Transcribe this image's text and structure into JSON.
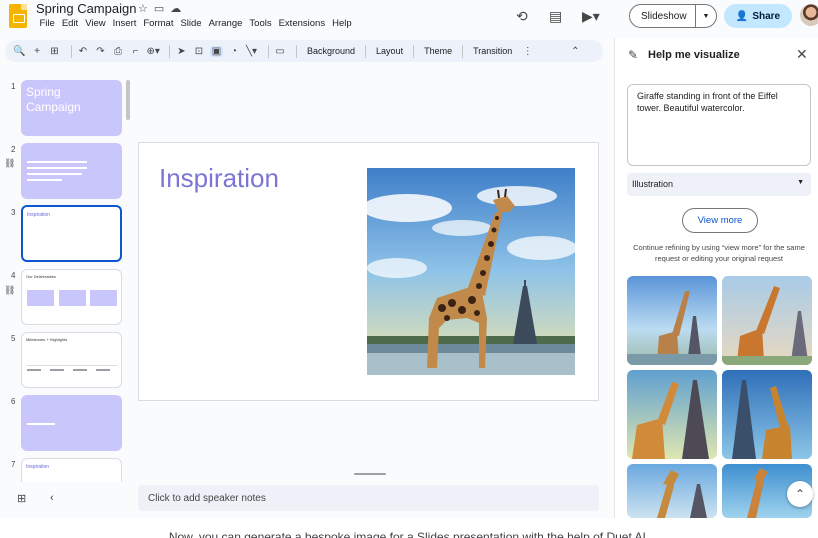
{
  "header": {
    "title": "Spring Campaign",
    "menu": [
      "File",
      "Edit",
      "View",
      "Insert",
      "Format",
      "Slide",
      "Arrange",
      "Tools",
      "Extensions",
      "Help"
    ],
    "slideshow_label": "Slideshow",
    "share_label": "Share"
  },
  "toolbar": {
    "background_label": "Background",
    "layout_label": "Layout",
    "theme_label": "Theme",
    "transition_label": "Transition"
  },
  "filmstrip": {
    "slides": [
      {
        "num": "1",
        "title": "Spring Campaign"
      },
      {
        "num": "2",
        "text": "Intro body text"
      },
      {
        "num": "3",
        "title": "Inspiration"
      },
      {
        "num": "4",
        "title": "Our Deliverables"
      },
      {
        "num": "5",
        "title": "Milestones + Highlights"
      },
      {
        "num": "6",
        "text": "Body text"
      },
      {
        "num": "7",
        "title": "Inspiration"
      }
    ]
  },
  "slide": {
    "title": "Inspiration"
  },
  "notes": {
    "placeholder": "Click to add speaker notes"
  },
  "panel": {
    "title": "Help me visualize",
    "prompt": "Giraffe standing in front of the Eiffel tower. Beautiful watercolor.",
    "style": "Illustration",
    "view_more_label": "View more",
    "refine_line1": "Continue refining by using “view more” for the same",
    "refine_line2": "request or editing your original request"
  },
  "caption": "Now, you can generate a bespoke image for a Slides presentation with the help of Duet AI."
}
